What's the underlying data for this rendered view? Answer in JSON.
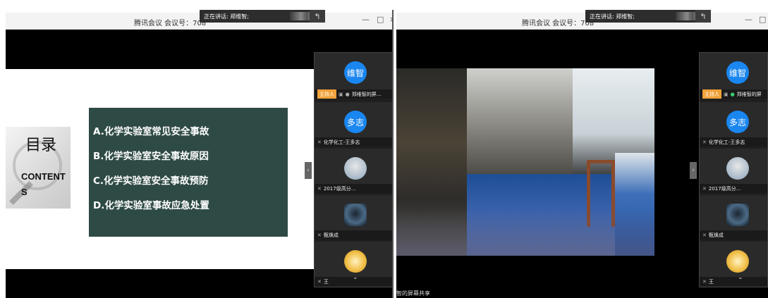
{
  "windows": [
    {
      "title": "腾讯会议 会议号：708",
      "speaking_label": "正在讲话: 郑维智;",
      "slide": {
        "mulu": "目录",
        "contents": "CONTENT\nS",
        "toc": [
          "A.化学实验室常见安全事故",
          "B.化学实验室安全事故原因",
          "C.化学实验室安全事故预防",
          "D.化学实验室事故应急处置"
        ]
      }
    },
    {
      "title": "腾讯会议 会议号：708",
      "speaking_label": "正在讲话: 郑维智;",
      "caption": "智的屏幕共享"
    }
  ],
  "participants_win1": [
    {
      "avatar_text": "维智",
      "label": "郑维智的屏...",
      "host": "主持人"
    },
    {
      "avatar_text": "多志",
      "label": "化学化工-王多志"
    },
    {
      "avatar_text": "",
      "label": "2017级高分..."
    },
    {
      "avatar_text": "",
      "label": "甄焕成"
    },
    {
      "avatar_text": "",
      "label": "王"
    }
  ],
  "participants_win2": [
    {
      "avatar_text": "维智",
      "label": "郑维智的屏",
      "host": "主持人"
    },
    {
      "avatar_text": "多志",
      "label": "化学化工-王多志"
    },
    {
      "avatar_text": "",
      "label": "2017级高分..."
    },
    {
      "avatar_text": "",
      "label": "甄焕成"
    },
    {
      "avatar_text": "",
      "label": "王"
    }
  ],
  "controls": {
    "minimize": "—",
    "maximize": "□",
    "close": "×",
    "expand": "›",
    "chevron": "⌄",
    "back": "↰"
  }
}
